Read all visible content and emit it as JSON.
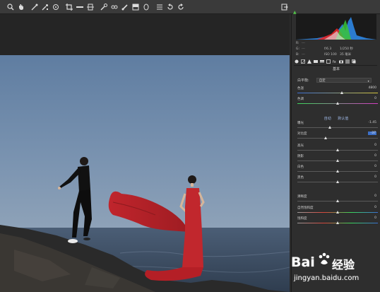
{
  "toolbar": {
    "tools": [
      "zoom-icon",
      "hand-icon",
      "white-balance-icon",
      "color-sampler-icon",
      "target-adjust-icon",
      "crop-icon",
      "straighten-icon",
      "transform-icon",
      "spot-removal-icon",
      "red-eye-icon",
      "adjustment-brush-icon",
      "graduated-filter-icon",
      "radial-filter-icon",
      "preferences-icon",
      "rotate-left-icon",
      "rotate-right-icon"
    ],
    "right_tool": "toggle-fullscreen-icon"
  },
  "histogram": {
    "warning_icon": "shadow-clipping-icon"
  },
  "camera_info": {
    "rows": [
      {
        "key": "R:",
        "val": "---",
        "a": "",
        "b": ""
      },
      {
        "key": "G:",
        "val": "---",
        "a": "f/6.3",
        "b": "1/250 秒"
      },
      {
        "key": "B:",
        "val": "---",
        "a": "ISO 100",
        "b": "35 毫米"
      }
    ]
  },
  "panel": {
    "section_title": "基本",
    "white_balance": {
      "label": "白平衡:",
      "value": "自定"
    },
    "tone_links": {
      "auto": "自动",
      "default": "默认值"
    },
    "sliders": [
      {
        "label": "色温",
        "value": "4800",
        "pos": 0.55,
        "color": "temp"
      },
      {
        "label": "色调",
        "value": "0",
        "pos": 0.5,
        "color": "tint"
      },
      {
        "label": "曝光",
        "value": "-1.45",
        "pos": 0.4,
        "color": "plain"
      },
      {
        "label": "对比度",
        "value": "-37",
        "pos": 0.35,
        "color": "plain",
        "active": true
      },
      {
        "label": "高光",
        "value": "0",
        "pos": 0.5,
        "color": "plain"
      },
      {
        "label": "阴影",
        "value": "0",
        "pos": 0.5,
        "color": "plain"
      },
      {
        "label": "白色",
        "value": "0",
        "pos": 0.5,
        "color": "plain"
      },
      {
        "label": "黑色",
        "value": "0",
        "pos": 0.5,
        "color": "plain"
      },
      {
        "label": "清晰度",
        "value": "0",
        "pos": 0.5,
        "color": "plain"
      },
      {
        "label": "自然饱和度",
        "value": "0",
        "pos": 0.5,
        "color": "sat"
      },
      {
        "label": "饱和度",
        "value": "0",
        "pos": 0.5,
        "color": "sat"
      }
    ]
  },
  "panel_tabs": [
    "basic-icon",
    "tone-curve-icon",
    "detail-icon",
    "hsl-icon",
    "split-toning-icon",
    "lens-icon",
    "fx-icon",
    "camera-calibration-icon",
    "presets-icon",
    "snapshots-icon"
  ],
  "watermark": {
    "logo": "Bai",
    "logo_cn": "经验",
    "url": "jingyan.baidu.com"
  },
  "colors": {
    "panel_bg": "#2e2e2e",
    "toolbar_bg": "#3a3a3a",
    "sky": "#6f8aa8",
    "sea": "#3b4b5e",
    "dress_red": "#c1272d",
    "active_value_bg": "#3d70c8"
  }
}
